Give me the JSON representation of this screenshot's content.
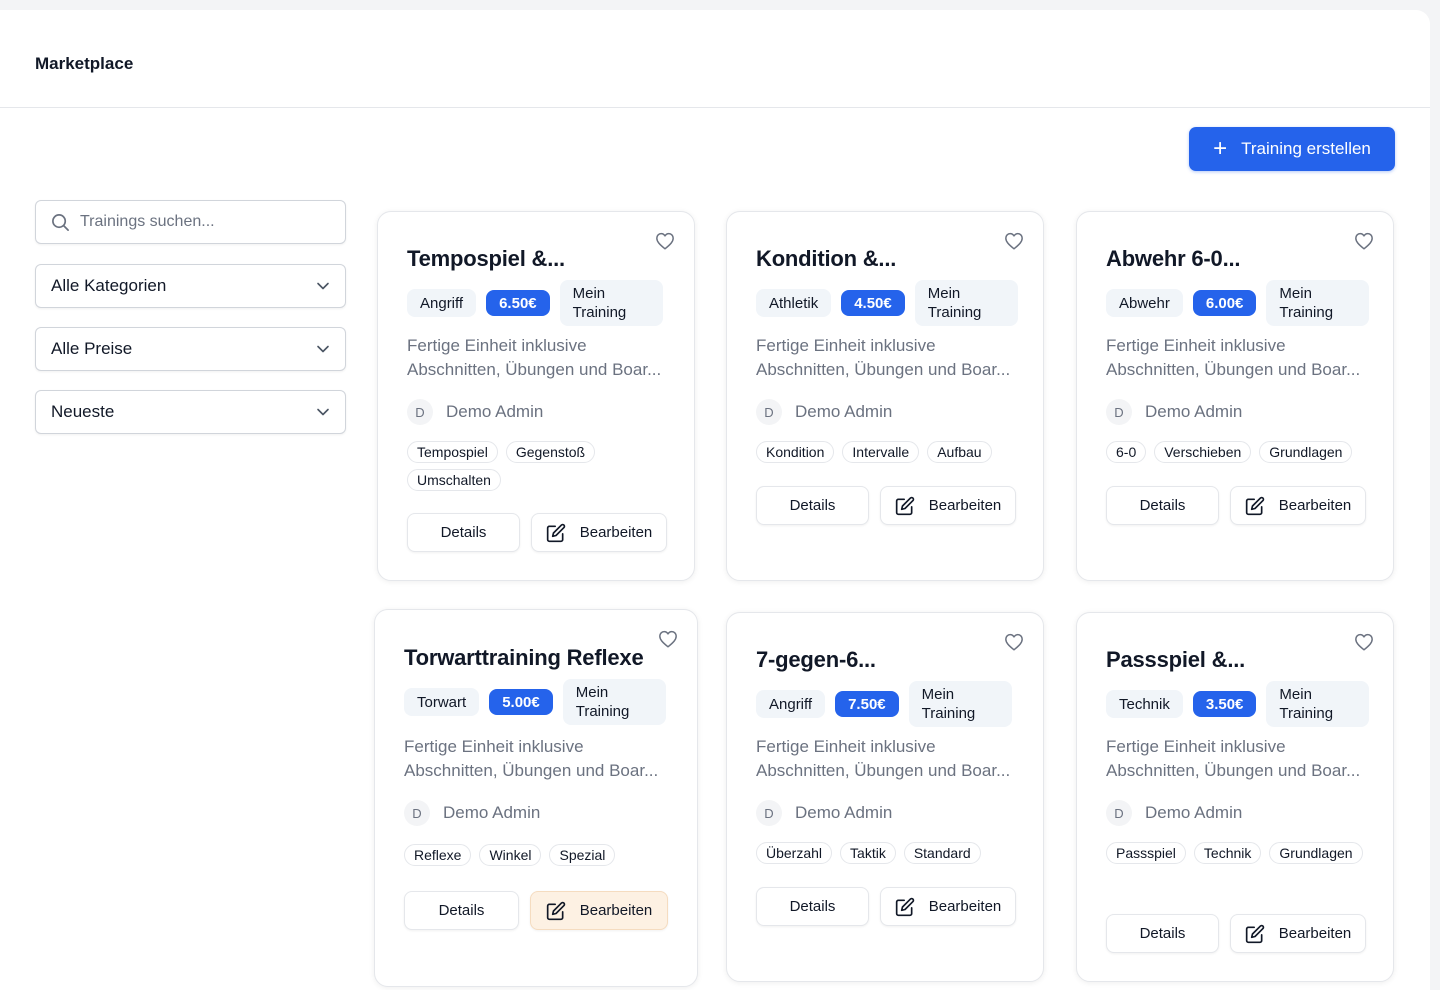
{
  "header": {
    "title": "Marketplace"
  },
  "create_button": {
    "label": "Training erstellen"
  },
  "filters": {
    "search_placeholder": "Trainings suchen...",
    "category": "Alle Kategorien",
    "price": "Alle Preise",
    "sort": "Neueste"
  },
  "common": {
    "own_badge": "Mein Training",
    "description": "Fertige Einheit inklusive Abschnitten, Übungen und Boar...",
    "author_initial": "D",
    "author_name": "Demo Admin",
    "details_label": "Details",
    "edit_label": "Bearbeiten"
  },
  "cards": [
    {
      "title": "Tempospiel &...",
      "category": "Angriff",
      "price": "6.50€",
      "tags": [
        "Tempospiel",
        "Gegenstoß",
        "Umschalten"
      ]
    },
    {
      "title": "Kondition &...",
      "category": "Athletik",
      "price": "4.50€",
      "tags": [
        "Kondition",
        "Intervalle",
        "Aufbau"
      ]
    },
    {
      "title": "Abwehr 6-0...",
      "category": "Abwehr",
      "price": "6.00€",
      "tags": [
        "6-0",
        "Verschieben",
        "Grundlagen"
      ]
    },
    {
      "title": "Torwarttraining Reflexe",
      "category": "Torwart",
      "price": "5.00€",
      "tags": [
        "Reflexe",
        "Winkel",
        "Spezial"
      ]
    },
    {
      "title": "7-gegen-6...",
      "category": "Angriff",
      "price": "7.50€",
      "tags": [
        "Überzahl",
        "Taktik",
        "Standard"
      ]
    },
    {
      "title": "Passspiel &...",
      "category": "Technik",
      "price": "3.50€",
      "tags": [
        "Passspiel",
        "Technik",
        "Grundlagen"
      ]
    }
  ]
}
